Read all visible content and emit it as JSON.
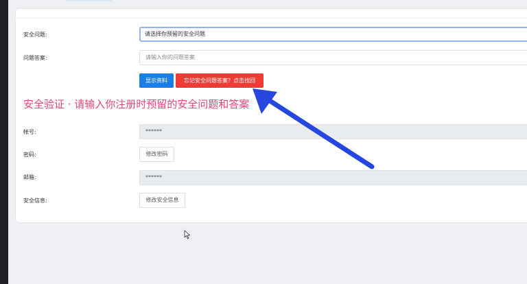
{
  "form": {
    "security_question_label": "安全问题:",
    "security_question_value": "请选择你预留的安全问题",
    "answer_label": "问题答案:",
    "answer_placeholder": "请输入你的问题答案",
    "show_button": "显示资料",
    "forgot_button": "忘记安全问题答案？点击找回"
  },
  "verify_title": "安全验证 · 请输入你注册时预留的安全问题和答案",
  "account": {
    "account_label": "帐号:",
    "account_value": "******",
    "password_label": "密码:",
    "change_password_button": "修改密码",
    "email_label": "邮箱:",
    "email_value": "******",
    "security_info_label": "安全信息:",
    "change_security_button": "修改安全信息"
  },
  "colors": {
    "primary": "#1a7ee8",
    "danger": "#ef3b36",
    "title_pink": "#e0457b",
    "annotation_arrow": "#2646e0"
  },
  "icons": [
    "mouse-cursor-icon",
    "annotation-arrow"
  ]
}
